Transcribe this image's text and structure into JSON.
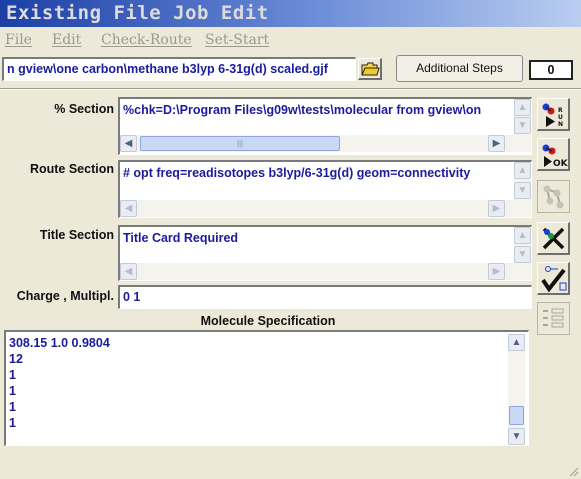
{
  "window": {
    "title": "Existing File Job Edit"
  },
  "menu": {
    "items": [
      "File",
      "Edit",
      "Check-Route",
      "Set-Start"
    ]
  },
  "file": {
    "path": "n gview\\one carbon\\methane b3lyp 6-31g(d) scaled.gjf"
  },
  "additional_steps": {
    "label": "Additional Steps"
  },
  "step_counter": {
    "value": "0"
  },
  "sections": {
    "link0": {
      "label": "% Section",
      "value": "%chk=D:\\Program Files\\g09w\\tests\\molecular from gview\\on"
    },
    "route": {
      "label": "Route Section",
      "value": "# opt freq=readisotopes b3lyp/6-31g(d) geom=connectivity"
    },
    "title": {
      "label": "Title Section",
      "value": "Title Card Required"
    },
    "charge": {
      "label": "Charge , Multipl.",
      "value": "0 1"
    }
  },
  "molecule": {
    "heading": "Molecule Specification",
    "lines": [
      "308.15 1.0 0.9804",
      "12",
      "1",
      "1",
      "1",
      "1"
    ]
  },
  "side_toolbar": {
    "icons": [
      "run-icon",
      "ok-icon",
      "molecule-disabled-icon",
      "cancel-icon",
      "check-icon",
      "list-disabled-icon"
    ]
  }
}
